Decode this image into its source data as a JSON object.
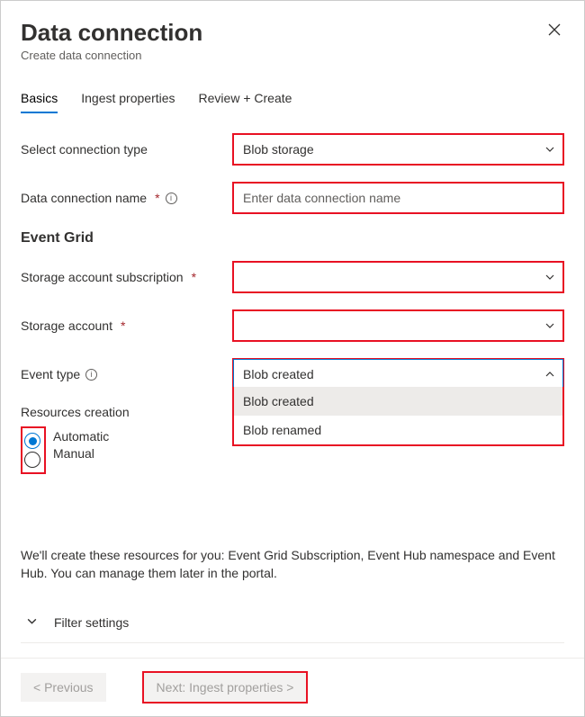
{
  "header": {
    "title": "Data connection",
    "subtitle": "Create data connection"
  },
  "tabs": {
    "basics": "Basics",
    "ingest": "Ingest properties",
    "review": "Review + Create"
  },
  "form": {
    "connection_type_label": "Select connection type",
    "connection_type_value": "Blob storage",
    "name_label": "Data connection name",
    "name_placeholder": "Enter data connection name",
    "name_value": "",
    "event_grid_heading": "Event Grid",
    "subscription_label": "Storage account subscription",
    "subscription_value": "",
    "storage_account_label": "Storage account",
    "storage_account_value": "",
    "event_type_label": "Event type",
    "event_type_value": "Blob created",
    "event_type_options": [
      "Blob created",
      "Blob renamed"
    ],
    "resources_creation_label": "Resources creation",
    "resources_creation_options": {
      "automatic": "Automatic",
      "manual": "Manual"
    },
    "resources_creation_value": "Automatic",
    "help_text": "We'll create these resources for you: Event Grid Subscription, Event Hub namespace and Event Hub. You can manage them later in the portal.",
    "filter_settings_label": "Filter settings"
  },
  "footer": {
    "previous": "< Previous",
    "next": "Next: Ingest properties >"
  }
}
